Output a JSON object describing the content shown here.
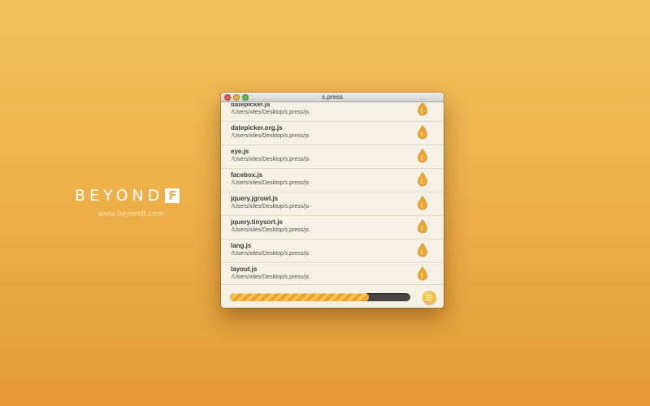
{
  "brand": {
    "name": "BEYOND",
    "mark_letter": "F",
    "url": "www.beyondf.com"
  },
  "window": {
    "title": "s.press",
    "controls": [
      "close",
      "minimize",
      "zoom"
    ]
  },
  "files": [
    {
      "name": "datepicker.js",
      "path": "/Users/xiles/Desktop/s.press/js"
    },
    {
      "name": "datepicker.org.js",
      "path": "/Users/xiles/Desktop/s.press/js"
    },
    {
      "name": "eye.js",
      "path": "/Users/xiles/Desktop/s.press/js"
    },
    {
      "name": "facebox.js",
      "path": "/Users/xiles/Desktop/s.press/js"
    },
    {
      "name": "jquery.jgrowl.js",
      "path": "/Users/xiles/Desktop/s.press/js"
    },
    {
      "name": "jquery.tinysort.js",
      "path": "/Users/xiles/Desktop/s.press/js"
    },
    {
      "name": "lang.js",
      "path": "/Users/xiles/Desktop/s.press/js"
    },
    {
      "name": "layout.js",
      "path": "/Users/xiles/Desktop/s.press/js"
    }
  ],
  "progress": {
    "percent": 77
  },
  "icons": {
    "file_status": "drop-icon",
    "menu": "menu-icon"
  },
  "colors": {
    "accent": "#f1a82c",
    "background": "#eeb14b",
    "window": "#f6f1e5"
  }
}
